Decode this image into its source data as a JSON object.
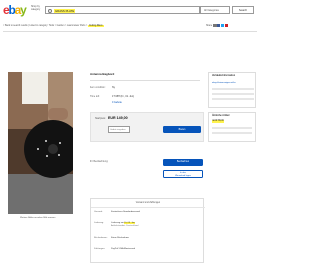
{
  "header": {
    "logo_letters": [
      "e",
      "b",
      "a",
      "y"
    ],
    "shop_by_category": "Shop by category",
    "search_query": "GRASS PLATE",
    "category_select": "All Categories",
    "search_button": "Search"
  },
  "breadcrumb": {
    "prefix": "< Back to search results | Listed in category:",
    "trail": "Tools > Garden > Lawnmower Parts >",
    "highlight": "Cutting Discs"
  },
  "share": {
    "label": "Share",
    "icons": [
      "email-icon",
      "facebook-icon",
      "twitter-icon",
      "pinterest-icon"
    ],
    "colors": [
      "#777777",
      "#3b5998",
      "#1da1f2",
      "#cb2027"
    ]
  },
  "item": {
    "title": "Antenna Bagbord",
    "condition_label": "Item condition:",
    "condition_value": "Ny",
    "time_left_label": "Time left:",
    "time_left_value": "1T 08H (Fr., 01. Jun)",
    "bid_history": "0 Gebote",
    "price_label": "Startpreis:",
    "price": "EUR 149,00",
    "bid_placeholder": "Gebot eingeben",
    "bid_button": "Bieten",
    "watching_label": "Ihr Beobachtung:",
    "watch_button": "Beobachten",
    "cart_button_line1": "In den",
    "cart_button_line2": "Warenkorb legen",
    "image_links": [
      "Weitere Bilder ansehen",
      "Bild zoomen"
    ]
  },
  "shipping": {
    "header": "Versand und Zahlungen",
    "rows": [
      {
        "key": "Versand:",
        "value": "Kostenloser Standardversand",
        "highlight": "",
        "sub": ""
      },
      {
        "key": "Lieferung:",
        "value": "Lieferung am",
        "highlight": "Di, 05. Jun",
        "sub": "Artikelstandort: Deutschland"
      },
      {
        "key": "Rücknahmen:",
        "value": "Keine Rücknahme",
        "highlight": "",
        "sub": ""
      },
      {
        "key": "Zahlungen:",
        "value": "PayPal  VISA  Mastercard",
        "highlight": "",
        "sub": ""
      }
    ]
  },
  "seller": {
    "title": "Verkäuferinformation",
    "name": "ebay-kleinanzeigen-seller"
  },
  "similar": {
    "title": "Ähnliche Artikel",
    "price": "EUR 89,00"
  }
}
